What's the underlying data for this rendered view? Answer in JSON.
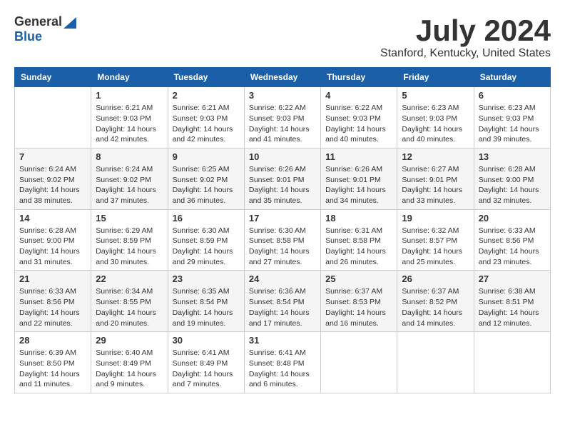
{
  "logo": {
    "general": "General",
    "blue": "Blue"
  },
  "title": "July 2024",
  "location": "Stanford, Kentucky, United States",
  "days_of_week": [
    "Sunday",
    "Monday",
    "Tuesday",
    "Wednesday",
    "Thursday",
    "Friday",
    "Saturday"
  ],
  "weeks": [
    [
      {
        "day": "",
        "info": ""
      },
      {
        "day": "1",
        "info": "Sunrise: 6:21 AM\nSunset: 9:03 PM\nDaylight: 14 hours\nand 42 minutes."
      },
      {
        "day": "2",
        "info": "Sunrise: 6:21 AM\nSunset: 9:03 PM\nDaylight: 14 hours\nand 42 minutes."
      },
      {
        "day": "3",
        "info": "Sunrise: 6:22 AM\nSunset: 9:03 PM\nDaylight: 14 hours\nand 41 minutes."
      },
      {
        "day": "4",
        "info": "Sunrise: 6:22 AM\nSunset: 9:03 PM\nDaylight: 14 hours\nand 40 minutes."
      },
      {
        "day": "5",
        "info": "Sunrise: 6:23 AM\nSunset: 9:03 PM\nDaylight: 14 hours\nand 40 minutes."
      },
      {
        "day": "6",
        "info": "Sunrise: 6:23 AM\nSunset: 9:03 PM\nDaylight: 14 hours\nand 39 minutes."
      }
    ],
    [
      {
        "day": "7",
        "info": "Sunrise: 6:24 AM\nSunset: 9:02 PM\nDaylight: 14 hours\nand 38 minutes."
      },
      {
        "day": "8",
        "info": "Sunrise: 6:24 AM\nSunset: 9:02 PM\nDaylight: 14 hours\nand 37 minutes."
      },
      {
        "day": "9",
        "info": "Sunrise: 6:25 AM\nSunset: 9:02 PM\nDaylight: 14 hours\nand 36 minutes."
      },
      {
        "day": "10",
        "info": "Sunrise: 6:26 AM\nSunset: 9:01 PM\nDaylight: 14 hours\nand 35 minutes."
      },
      {
        "day": "11",
        "info": "Sunrise: 6:26 AM\nSunset: 9:01 PM\nDaylight: 14 hours\nand 34 minutes."
      },
      {
        "day": "12",
        "info": "Sunrise: 6:27 AM\nSunset: 9:01 PM\nDaylight: 14 hours\nand 33 minutes."
      },
      {
        "day": "13",
        "info": "Sunrise: 6:28 AM\nSunset: 9:00 PM\nDaylight: 14 hours\nand 32 minutes."
      }
    ],
    [
      {
        "day": "14",
        "info": "Sunrise: 6:28 AM\nSunset: 9:00 PM\nDaylight: 14 hours\nand 31 minutes."
      },
      {
        "day": "15",
        "info": "Sunrise: 6:29 AM\nSunset: 8:59 PM\nDaylight: 14 hours\nand 30 minutes."
      },
      {
        "day": "16",
        "info": "Sunrise: 6:30 AM\nSunset: 8:59 PM\nDaylight: 14 hours\nand 29 minutes."
      },
      {
        "day": "17",
        "info": "Sunrise: 6:30 AM\nSunset: 8:58 PM\nDaylight: 14 hours\nand 27 minutes."
      },
      {
        "day": "18",
        "info": "Sunrise: 6:31 AM\nSunset: 8:58 PM\nDaylight: 14 hours\nand 26 minutes."
      },
      {
        "day": "19",
        "info": "Sunrise: 6:32 AM\nSunset: 8:57 PM\nDaylight: 14 hours\nand 25 minutes."
      },
      {
        "day": "20",
        "info": "Sunrise: 6:33 AM\nSunset: 8:56 PM\nDaylight: 14 hours\nand 23 minutes."
      }
    ],
    [
      {
        "day": "21",
        "info": "Sunrise: 6:33 AM\nSunset: 8:56 PM\nDaylight: 14 hours\nand 22 minutes."
      },
      {
        "day": "22",
        "info": "Sunrise: 6:34 AM\nSunset: 8:55 PM\nDaylight: 14 hours\nand 20 minutes."
      },
      {
        "day": "23",
        "info": "Sunrise: 6:35 AM\nSunset: 8:54 PM\nDaylight: 14 hours\nand 19 minutes."
      },
      {
        "day": "24",
        "info": "Sunrise: 6:36 AM\nSunset: 8:54 PM\nDaylight: 14 hours\nand 17 minutes."
      },
      {
        "day": "25",
        "info": "Sunrise: 6:37 AM\nSunset: 8:53 PM\nDaylight: 14 hours\nand 16 minutes."
      },
      {
        "day": "26",
        "info": "Sunrise: 6:37 AM\nSunset: 8:52 PM\nDaylight: 14 hours\nand 14 minutes."
      },
      {
        "day": "27",
        "info": "Sunrise: 6:38 AM\nSunset: 8:51 PM\nDaylight: 14 hours\nand 12 minutes."
      }
    ],
    [
      {
        "day": "28",
        "info": "Sunrise: 6:39 AM\nSunset: 8:50 PM\nDaylight: 14 hours\nand 11 minutes."
      },
      {
        "day": "29",
        "info": "Sunrise: 6:40 AM\nSunset: 8:49 PM\nDaylight: 14 hours\nand 9 minutes."
      },
      {
        "day": "30",
        "info": "Sunrise: 6:41 AM\nSunset: 8:49 PM\nDaylight: 14 hours\nand 7 minutes."
      },
      {
        "day": "31",
        "info": "Sunrise: 6:41 AM\nSunset: 8:48 PM\nDaylight: 14 hours\nand 6 minutes."
      },
      {
        "day": "",
        "info": ""
      },
      {
        "day": "",
        "info": ""
      },
      {
        "day": "",
        "info": ""
      }
    ]
  ]
}
